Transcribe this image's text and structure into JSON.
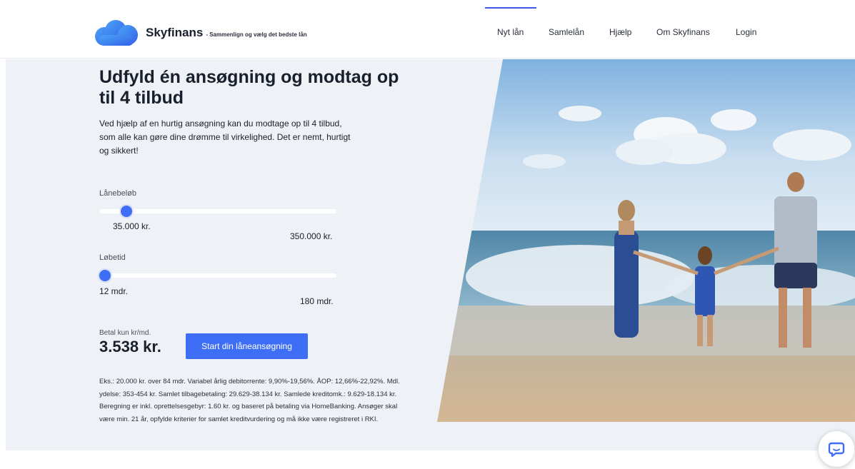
{
  "header": {
    "brand_name": "Skyfinans",
    "tagline": "- Sammenlign og vælg det bedste lån",
    "nav": [
      "Nyt lån",
      "Samlelån",
      "Hjælp",
      "Om Skyfinans",
      "Login"
    ],
    "active_nav": "Nyt lån"
  },
  "hero": {
    "title": "Udfyld én ansøgning og modtag op til 4 tilbud",
    "lead": "Ved hjælp af en hurtig ansøgning kan du modtage op til 4 tilbud, som alle kan gøre dine drømme til virkelighed. Det er nemt, hurtigt og sikkert!",
    "amount_slider": {
      "label": "Lånebeløb",
      "current": "35.000 kr.",
      "max": "350.000 kr.",
      "fraction": 0.095
    },
    "term_slider": {
      "label": "Løbetid",
      "current": "12 mdr.",
      "max": "180 mdr.",
      "fraction": 0.0
    },
    "payment_label": "Betal kun kr/md.",
    "payment_amount": "3.538 kr.",
    "cta_label": "Start din låneansøgning",
    "disclaimer": "Eks.: 20.000 kr. over 84 mdr. Variabel årlig debitorrente: 9,90%-19,56%. ÅOP: 12,66%-22,92%. Mdl. ydelse: 353-454 kr. Samlet tilbagebetaling: 29.629-38.134 kr. Samlede kreditomk.: 9.629-18.134 kr. Beregning er inkl. oprettelsesgebyr: 1.60 kr. og baseret på betaling via HomeBanking. Ansøger skal være min. 21 år, opfylde kriterier for samlet kreditvurdering og må ikke være registreret i RKI."
  },
  "colors": {
    "accent": "#3d6ef5",
    "nav_active": "#3d57e6",
    "hero_bg": "#eef1f5"
  }
}
